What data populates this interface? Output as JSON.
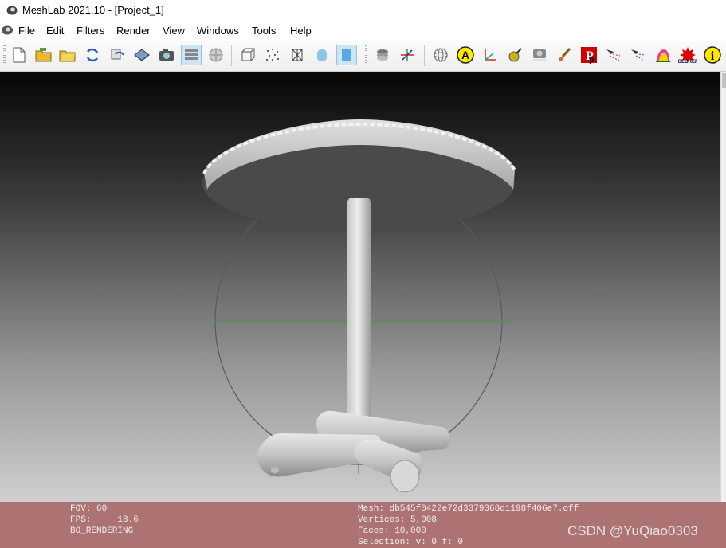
{
  "window": {
    "title": "MeshLab 2021.10 - [Project_1]"
  },
  "menu": [
    "File",
    "Edit",
    "Filters",
    "Render",
    "View",
    "Windows",
    "Tools",
    "Help"
  ],
  "toolbar": {
    "buttons": [
      {
        "name": "new-project",
        "icon": "new-document-icon"
      },
      {
        "name": "open-project",
        "icon": "open-folder-icon"
      },
      {
        "name": "import-mesh",
        "icon": "import-folder-icon"
      },
      {
        "name": "reload",
        "icon": "reload-icon"
      },
      {
        "name": "reload-all",
        "icon": "reload-all-icon"
      },
      {
        "name": "export-mesh",
        "icon": "export-icon"
      },
      {
        "name": "snapshot",
        "icon": "camera-icon"
      },
      {
        "name": "layer-dialog",
        "icon": "layers-icon",
        "active": true
      },
      {
        "name": "raster-layer",
        "icon": "raster-icon"
      },
      {
        "name": "bounding-box",
        "icon": "bbox-icon"
      },
      {
        "name": "points",
        "icon": "points-icon"
      },
      {
        "name": "wireframe",
        "icon": "wireframe-icon"
      },
      {
        "name": "flat-shading",
        "icon": "flat-icon"
      },
      {
        "name": "smooth-shading",
        "icon": "smooth-icon",
        "active": true
      },
      {
        "name": "decorate-stack",
        "icon": "stack-icon"
      },
      {
        "name": "decorate-axes",
        "icon": "axes-burst-icon"
      },
      {
        "name": "trackball",
        "icon": "trackball-icon"
      },
      {
        "name": "show-labels",
        "icon": "label-a-icon"
      },
      {
        "name": "show-axis",
        "icon": "axis-icon"
      },
      {
        "name": "measure",
        "icon": "measure-icon"
      },
      {
        "name": "raster-align",
        "icon": "raster-align-icon"
      },
      {
        "name": "paint",
        "icon": "paintbrush-icon"
      },
      {
        "name": "pickpoints",
        "icon": "pickpoints-icon"
      },
      {
        "name": "select-vertices",
        "icon": "select-icon"
      },
      {
        "name": "select-connected",
        "icon": "select-connected-icon"
      },
      {
        "name": "z-paint",
        "icon": "zpaint-icon"
      },
      {
        "name": "georef",
        "icon": "georef-icon"
      },
      {
        "name": "info",
        "icon": "info-icon"
      }
    ]
  },
  "overlay": {
    "fov": "FOV: 60",
    "fps": "FPS:     18.6",
    "mode": "BO_RENDERING",
    "mesh": "Mesh: db545f0422e72d3379368d1198f406e7.off",
    "vertices": "Vertices: 5,008",
    "faces": "Faces: 10,000",
    "selection": "Selection: v: 0 f: 0"
  },
  "watermark": "CSDN @YuQiao0303",
  "colors": {
    "infobar": "#ad7373",
    "active_button": "#cde6f7"
  }
}
